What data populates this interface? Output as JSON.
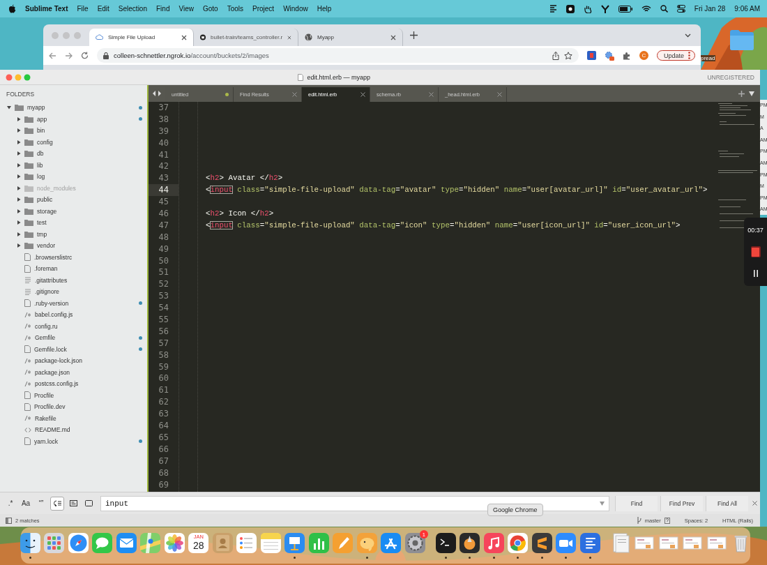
{
  "menubar": {
    "app": "Sublime Text",
    "menus": [
      "File",
      "Edit",
      "Selection",
      "Find",
      "View",
      "Goto",
      "Tools",
      "Project",
      "Window",
      "Help"
    ],
    "date": "Fri Jan 28",
    "time": "9:06 AM"
  },
  "browser": {
    "tabs": [
      {
        "title": "Simple File Upload",
        "kind": "page",
        "selected": true
      },
      {
        "title": "bullet-train/teams_controller.r",
        "kind": "github",
        "selected": false
      },
      {
        "title": "Myapp",
        "kind": "globe",
        "selected": false
      }
    ],
    "url_host": "colleen-schnettler.ngrok.io",
    "url_path": "/account/buckets/2/images",
    "profile_initial": "C",
    "update_button": "Update"
  },
  "desktop_label": "pread",
  "editor": {
    "title": "edit.html.erb — myapp",
    "license": "UNREGISTERED",
    "sidebar": {
      "header": "FOLDERS",
      "tree": [
        {
          "name": "myapp",
          "kind": "folder",
          "expanded": true,
          "modified": true,
          "ignored": false,
          "children": [
            {
              "name": "app",
              "kind": "folder",
              "expanded": false,
              "modified": true,
              "ignored": false
            },
            {
              "name": "bin",
              "kind": "folder",
              "expanded": false,
              "modified": false,
              "ignored": false
            },
            {
              "name": "config",
              "kind": "folder",
              "expanded": false,
              "modified": false,
              "ignored": false
            },
            {
              "name": "db",
              "kind": "folder",
              "expanded": false,
              "modified": false,
              "ignored": false
            },
            {
              "name": "lib",
              "kind": "folder",
              "expanded": false,
              "modified": false,
              "ignored": false
            },
            {
              "name": "log",
              "kind": "folder",
              "expanded": false,
              "modified": false,
              "ignored": false
            },
            {
              "name": "node_modules",
              "kind": "folder",
              "expanded": false,
              "modified": false,
              "ignored": true
            },
            {
              "name": "public",
              "kind": "folder",
              "expanded": false,
              "modified": false,
              "ignored": false
            },
            {
              "name": "storage",
              "kind": "folder",
              "expanded": false,
              "modified": false,
              "ignored": false
            },
            {
              "name": "test",
              "kind": "folder",
              "expanded": false,
              "modified": false,
              "ignored": false
            },
            {
              "name": "tmp",
              "kind": "folder",
              "expanded": false,
              "modified": false,
              "ignored": false
            },
            {
              "name": "vendor",
              "kind": "folder",
              "expanded": false,
              "modified": false,
              "ignored": false
            },
            {
              "name": ".browserslistrc",
              "kind": "file",
              "modified": false,
              "ignored": false
            },
            {
              "name": ".foreman",
              "kind": "file",
              "modified": false,
              "ignored": false
            },
            {
              "name": ".gitattributes",
              "kind": "text",
              "modified": false,
              "ignored": false
            },
            {
              "name": ".gitignore",
              "kind": "text",
              "modified": false,
              "ignored": false
            },
            {
              "name": ".ruby-version",
              "kind": "file",
              "modified": true,
              "ignored": false
            },
            {
              "name": "babel.config.js",
              "kind": "script",
              "modified": false,
              "ignored": false
            },
            {
              "name": "config.ru",
              "kind": "script",
              "modified": false,
              "ignored": false
            },
            {
              "name": "Gemfile",
              "kind": "script",
              "modified": true,
              "ignored": false
            },
            {
              "name": "Gemfile.lock",
              "kind": "file",
              "modified": true,
              "ignored": false
            },
            {
              "name": "package-lock.json",
              "kind": "script",
              "modified": false,
              "ignored": false
            },
            {
              "name": "package.json",
              "kind": "script",
              "modified": false,
              "ignored": false
            },
            {
              "name": "postcss.config.js",
              "kind": "script",
              "modified": false,
              "ignored": false
            },
            {
              "name": "Procfile",
              "kind": "file",
              "modified": false,
              "ignored": false
            },
            {
              "name": "Procfile.dev",
              "kind": "file",
              "modified": false,
              "ignored": false
            },
            {
              "name": "Rakefile",
              "kind": "script",
              "modified": false,
              "ignored": false
            },
            {
              "name": "README.md",
              "kind": "markup",
              "modified": false,
              "ignored": false
            },
            {
              "name": "yarn.lock",
              "kind": "file",
              "modified": true,
              "ignored": false
            }
          ]
        }
      ]
    },
    "tabs": [
      {
        "title": "untitled",
        "selected": false,
        "dirty": true
      },
      {
        "title": "Find Results",
        "selected": false,
        "dirty": false
      },
      {
        "title": "edit.html.erb",
        "selected": true,
        "dirty": false
      },
      {
        "title": "schema.rb",
        "selected": false,
        "dirty": false
      },
      {
        "title": "_head.html.erb",
        "selected": false,
        "dirty": false
      }
    ],
    "lines": [
      {
        "number": "37",
        "current": false
      },
      {
        "number": "38",
        "current": false
      },
      {
        "number": "39",
        "current": false
      },
      {
        "number": "40",
        "current": false
      },
      {
        "number": "41",
        "current": false
      },
      {
        "number": "42",
        "current": false
      },
      {
        "number": "43",
        "current": false,
        "tokens": [
          {
            "kind": "punct",
            "text": "<"
          },
          {
            "kind": "tag",
            "text": "h2"
          },
          {
            "kind": "punct",
            "text": ">"
          },
          {
            "kind": "text",
            "text": " Avatar "
          },
          {
            "kind": "punct",
            "text": "</"
          },
          {
            "kind": "tag",
            "text": "h2"
          },
          {
            "kind": "punct",
            "text": ">"
          }
        ]
      },
      {
        "number": "44",
        "current": true,
        "tokens": [
          {
            "kind": "punct",
            "text": "<"
          },
          {
            "kind": "match",
            "text": "input"
          },
          {
            "kind": "attr",
            "text": " class"
          },
          {
            "kind": "punct",
            "text": "="
          },
          {
            "kind": "string",
            "text": "\"simple-file-upload\""
          },
          {
            "kind": "attr",
            "text": " data-tag"
          },
          {
            "kind": "punct",
            "text": "="
          },
          {
            "kind": "string",
            "text": "\"avatar\""
          },
          {
            "kind": "attr",
            "text": " type"
          },
          {
            "kind": "punct",
            "text": "="
          },
          {
            "kind": "string",
            "text": "\"hidden\""
          },
          {
            "kind": "attr",
            "text": " name"
          },
          {
            "kind": "punct",
            "text": "="
          },
          {
            "kind": "string",
            "text": "\"user[avatar_url]\""
          },
          {
            "kind": "attr",
            "text": " id"
          },
          {
            "kind": "punct",
            "text": "="
          },
          {
            "kind": "string",
            "text": "\"user_avatar_url\""
          },
          {
            "kind": "punct",
            "text": ">"
          }
        ]
      },
      {
        "number": "45",
        "current": false
      },
      {
        "number": "46",
        "current": false,
        "tokens": [
          {
            "kind": "punct",
            "text": "<"
          },
          {
            "kind": "tag",
            "text": "h2"
          },
          {
            "kind": "punct",
            "text": ">"
          },
          {
            "kind": "text",
            "text": " Icon "
          },
          {
            "kind": "punct",
            "text": "</"
          },
          {
            "kind": "tag",
            "text": "h2"
          },
          {
            "kind": "punct",
            "text": ">"
          }
        ]
      },
      {
        "number": "47",
        "current": false,
        "tokens": [
          {
            "kind": "punct",
            "text": "<"
          },
          {
            "kind": "match",
            "text": "input"
          },
          {
            "kind": "attr",
            "text": " class"
          },
          {
            "kind": "punct",
            "text": "="
          },
          {
            "kind": "string",
            "text": "\"simple-file-upload\""
          },
          {
            "kind": "attr",
            "text": " data-tag"
          },
          {
            "kind": "punct",
            "text": "="
          },
          {
            "kind": "string",
            "text": "\"icon\""
          },
          {
            "kind": "attr",
            "text": " type"
          },
          {
            "kind": "punct",
            "text": "="
          },
          {
            "kind": "string",
            "text": "\"hidden\""
          },
          {
            "kind": "attr",
            "text": " name"
          },
          {
            "kind": "punct",
            "text": "="
          },
          {
            "kind": "string",
            "text": "\"user[icon_url]\""
          },
          {
            "kind": "attr",
            "text": " id"
          },
          {
            "kind": "punct",
            "text": "="
          },
          {
            "kind": "string",
            "text": "\"user_icon_url\""
          },
          {
            "kind": "punct",
            "text": ">"
          }
        ]
      },
      {
        "number": "48",
        "current": false
      },
      {
        "number": "49",
        "current": false
      },
      {
        "number": "50",
        "current": false
      },
      {
        "number": "51",
        "current": false
      },
      {
        "number": "52",
        "current": false
      },
      {
        "number": "53",
        "current": false
      },
      {
        "number": "54",
        "current": false
      },
      {
        "number": "55",
        "current": false
      },
      {
        "number": "56",
        "current": false
      },
      {
        "number": "57",
        "current": false
      },
      {
        "number": "58",
        "current": false
      },
      {
        "number": "59",
        "current": false
      },
      {
        "number": "60",
        "current": false
      },
      {
        "number": "61",
        "current": false
      },
      {
        "number": "62",
        "current": false
      },
      {
        "number": "63",
        "current": false
      },
      {
        "number": "64",
        "current": false
      },
      {
        "number": "65",
        "current": false
      },
      {
        "number": "66",
        "current": false
      },
      {
        "number": "67",
        "current": false
      },
      {
        "number": "68",
        "current": false
      },
      {
        "number": "69",
        "current": false
      }
    ],
    "find": {
      "text_toggles": [
        {
          "label": ".*",
          "selected": false
        },
        {
          "label": "Aa",
          "selected": false
        },
        {
          "label": "“”",
          "selected": false
        }
      ],
      "icon_toggles": [
        {
          "kind": "wrap",
          "selected": true
        },
        {
          "kind": "in_selection",
          "selected": false
        },
        {
          "kind": "highlight",
          "selected": false
        }
      ],
      "value": "input",
      "buttons": [
        "Find",
        "Find Prev",
        "Find All"
      ]
    },
    "status": {
      "matches": "2 matches",
      "branch": "master",
      "indent": "Spaces: 2",
      "syntax": "HTML (Rails)"
    }
  },
  "calendar_fragments": [
    "PM",
    "M",
    "A",
    "AM",
    "PM",
    "AM",
    "PM",
    "M",
    "PM",
    "AM"
  ],
  "recorder": {
    "time": "00:37"
  },
  "tooltip": "Google Chrome",
  "dock": [
    {
      "kind": "finder",
      "running": true
    },
    {
      "kind": "launchpad",
      "running": false
    },
    {
      "kind": "safari",
      "running": false
    },
    {
      "kind": "messages",
      "running": false
    },
    {
      "kind": "mail",
      "running": false
    },
    {
      "kind": "maps",
      "running": false
    },
    {
      "kind": "photos",
      "running": false
    },
    {
      "kind": "calendar",
      "running": false,
      "month": "JAN",
      "day": "28"
    },
    {
      "kind": "contacts",
      "running": false
    },
    {
      "kind": "reminders",
      "running": false
    },
    {
      "kind": "notes",
      "running": false
    },
    {
      "kind": "keynote",
      "running": true
    },
    {
      "kind": "numbers",
      "running": false
    },
    {
      "kind": "pages",
      "running": false
    },
    {
      "kind": "tableplus",
      "running": true
    },
    {
      "kind": "appstore",
      "running": false
    },
    {
      "kind": "settings",
      "running": false,
      "badge": "1"
    },
    {
      "kind": "terminal",
      "running": true
    },
    {
      "kind": "gitapp",
      "running": true
    },
    {
      "kind": "music",
      "running": true
    },
    {
      "kind": "chrome",
      "running": true
    },
    {
      "kind": "sublime",
      "running": true
    },
    {
      "kind": "zoom",
      "running": true
    },
    {
      "kind": "docs",
      "running": true
    },
    {
      "kind": "preview",
      "running": false
    },
    {
      "kind": "thumbnail",
      "running": false
    },
    {
      "kind": "thumbnail",
      "running": false
    },
    {
      "kind": "thumbnail",
      "running": false
    },
    {
      "kind": "thumbnail",
      "running": false
    },
    {
      "kind": "trash",
      "running": false
    }
  ]
}
